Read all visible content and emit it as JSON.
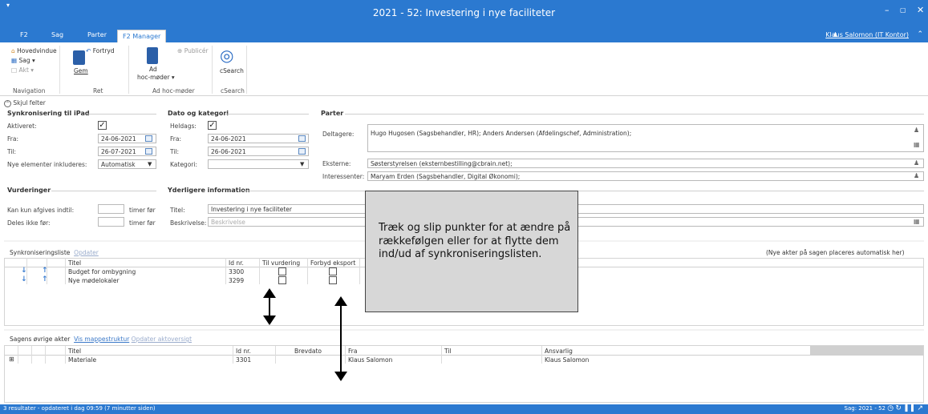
{
  "window": {
    "title": "2021 - 52: Investering i nye faciliteter",
    "user": "Klaus Salomon (IT Kontor)",
    "quick_access": "▾"
  },
  "tabs": [
    "F2",
    "Sag",
    "Parter",
    "F2 Manager"
  ],
  "ribbon": {
    "navigation": {
      "label": "Navigation",
      "hovedvindue": "Hovedvindue",
      "sag": "Sag ▾",
      "akt": "Akt ▾"
    },
    "ret": {
      "label": "Ret",
      "gem": "Gem",
      "fortryd": "Fortryd"
    },
    "adhoc": {
      "label": "Ad hoc-møder",
      "button": "Ad",
      "button2": "hoc-møder ▾",
      "publicer": "Publicér"
    },
    "csearch": {
      "label": "cSearch",
      "button": "cSearch"
    }
  },
  "collapse": {
    "label": "Skjul felter"
  },
  "sync": {
    "header": "Synkronisering til iPad",
    "aktiveret_label": "Aktiveret:",
    "fra_label": "Fra:",
    "fra_value": "24-06-2021",
    "til_label": "Til:",
    "til_value": "26-07-2021",
    "nye_label": "Nye elementer inkluderes:",
    "nye_value": "Automatisk"
  },
  "dato": {
    "header": "Dato og kategori",
    "heldags_label": "Heldags:",
    "fra_label": "Fra:",
    "fra_value": "24-06-2021",
    "til_label": "Til:",
    "til_value": "26-06-2021",
    "kategori_label": "Kategori:",
    "kategori_value": ""
  },
  "parter": {
    "header": "Parter",
    "deltagere_label": "Deltagere:",
    "deltagere_value": "Hugo Hugosen (Sagsbehandler, HR); Anders Andersen (Afdelingschef, Administration);",
    "eksterne_label": "Eksterne:",
    "eksterne_value": "Søsterstyrelsen (eksternbestilling@cbrain.net);",
    "interessenter_label": "Interessenter:",
    "interessenter_value": "Maryam Erden (Sagsbehandler, Digital Økonomi);"
  },
  "vurderinger": {
    "header": "Vurderinger",
    "kan_label": "Kan kun afgives indtil:",
    "kan_suffix": "timer før",
    "deles_label": "Deles ikke før:",
    "deles_suffix": "timer før"
  },
  "yderligere": {
    "header": "Yderligere information",
    "titel_label": "Titel:",
    "titel_value": "Investering i nye faciliteter",
    "beskrivelse_label": "Beskrivelse:",
    "beskrivelse_placeholder": "Beskrivelse"
  },
  "synclist": {
    "title": "Synkroniseringsliste",
    "update_link": "Opdater",
    "note": "(Nye akter på sagen placeres automatisk her)",
    "columns": [
      "Titel",
      "Id nr.",
      "Til vurdering",
      "Forbyd eksport"
    ],
    "rows": [
      {
        "titel": "Budget for ombygning",
        "id": "3300"
      },
      {
        "titel": "Nye mødelokaler",
        "id": "3299"
      }
    ]
  },
  "other": {
    "title": "Sagens øvrige akter",
    "link1": "Vis mappestruktur",
    "link2": "Opdater aktoversigt",
    "columns": [
      "Titel",
      "Id nr.",
      "Brevdato",
      "Fra",
      "Til",
      "Ansvarlig"
    ],
    "rows": [
      {
        "expand": "⊞",
        "titel": "Materiale",
        "id": "3301",
        "brevdato": "",
        "fra": "Klaus Salomon",
        "til": "",
        "ansvarlig": "Klaus Salomon"
      }
    ]
  },
  "callout": {
    "text": "Træk og slip punkter for at ændre på rækkefølgen eller for at flytte dem ind/ud af synkroniseringslisten."
  },
  "status": {
    "left": "3 resultater - opdateret i dag 09:59 (7 minutter siden)",
    "right": "Sag: 2021 - 52"
  },
  "colors": {
    "accent": "#2b79d0",
    "callout_bg": "#d7d7d7"
  }
}
